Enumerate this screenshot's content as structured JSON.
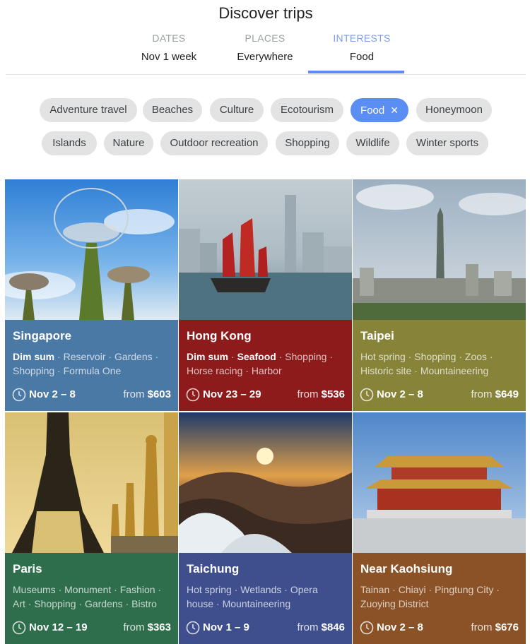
{
  "title": "Discover trips",
  "tabs": [
    {
      "label": "DATES",
      "value": "Nov 1 week"
    },
    {
      "label": "PLACES",
      "value": "Everywhere"
    },
    {
      "label": "INTERESTS",
      "value": "Food"
    }
  ],
  "active_tab": "INTERESTS",
  "chips": [
    "Adventure travel",
    "Beaches",
    "Culture",
    "Ecotourism",
    "Food",
    "Honeymoon",
    "Islands",
    "Nature",
    "Outdoor recreation",
    "Shopping",
    "Wildlife",
    "Winter sports"
  ],
  "selected_chip": "Food",
  "colors": {
    "accent": "#5b8ef2",
    "singapore": "#4b79a6",
    "hong_kong": "#8e1b1b",
    "taipei": "#87843a",
    "paris": "#2e6e4c",
    "taichung": "#3f4f8e",
    "kaohsiung": "#8a5226"
  },
  "icons": {
    "chip_remove": "close-icon",
    "card_dates": "clock-icon"
  },
  "cards": [
    {
      "city": "Singapore",
      "tags": [
        "Dim sum",
        "Reservoir",
        "Gardens",
        "Shopping",
        "Formula One"
      ],
      "highlighted": [
        "Dim sum"
      ],
      "dates": "Nov 2 – 8",
      "price_prefix": "from ",
      "price": "$603"
    },
    {
      "city": "Hong Kong",
      "tags": [
        "Dim sum",
        "Seafood",
        "Shopping",
        "Horse racing",
        "Harbor"
      ],
      "highlighted": [
        "Dim sum",
        "Seafood"
      ],
      "dates": "Nov 23 – 29",
      "price_prefix": "from ",
      "price": "$536"
    },
    {
      "city": "Taipei",
      "tags": [
        "Hot spring",
        "Shopping",
        "Zoos",
        "Historic site",
        "Mountaineering"
      ],
      "highlighted": [],
      "dates": "Nov 2 – 8",
      "price_prefix": "from ",
      "price": "$649"
    },
    {
      "city": "Paris",
      "tags": [
        "Museums",
        "Monument",
        "Fashion",
        "Art",
        "Shopping",
        "Gardens",
        "Bistro"
      ],
      "highlighted": [],
      "dates": "Nov 12 – 19",
      "price_prefix": "from ",
      "price": "$363"
    },
    {
      "city": "Taichung",
      "tags": [
        "Hot spring",
        "Wetlands",
        "Opera house",
        "Mountaineering"
      ],
      "highlighted": [],
      "dates": "Nov 1 – 9",
      "price_prefix": "from ",
      "price": "$846"
    },
    {
      "city": "Near Kaohsiung",
      "tags": [
        "Tainan",
        "Chiayi",
        "Pingtung City",
        "Zuoying District"
      ],
      "highlighted": [],
      "dates": "Nov 2 – 8",
      "price_prefix": "from ",
      "price": "$676"
    }
  ]
}
